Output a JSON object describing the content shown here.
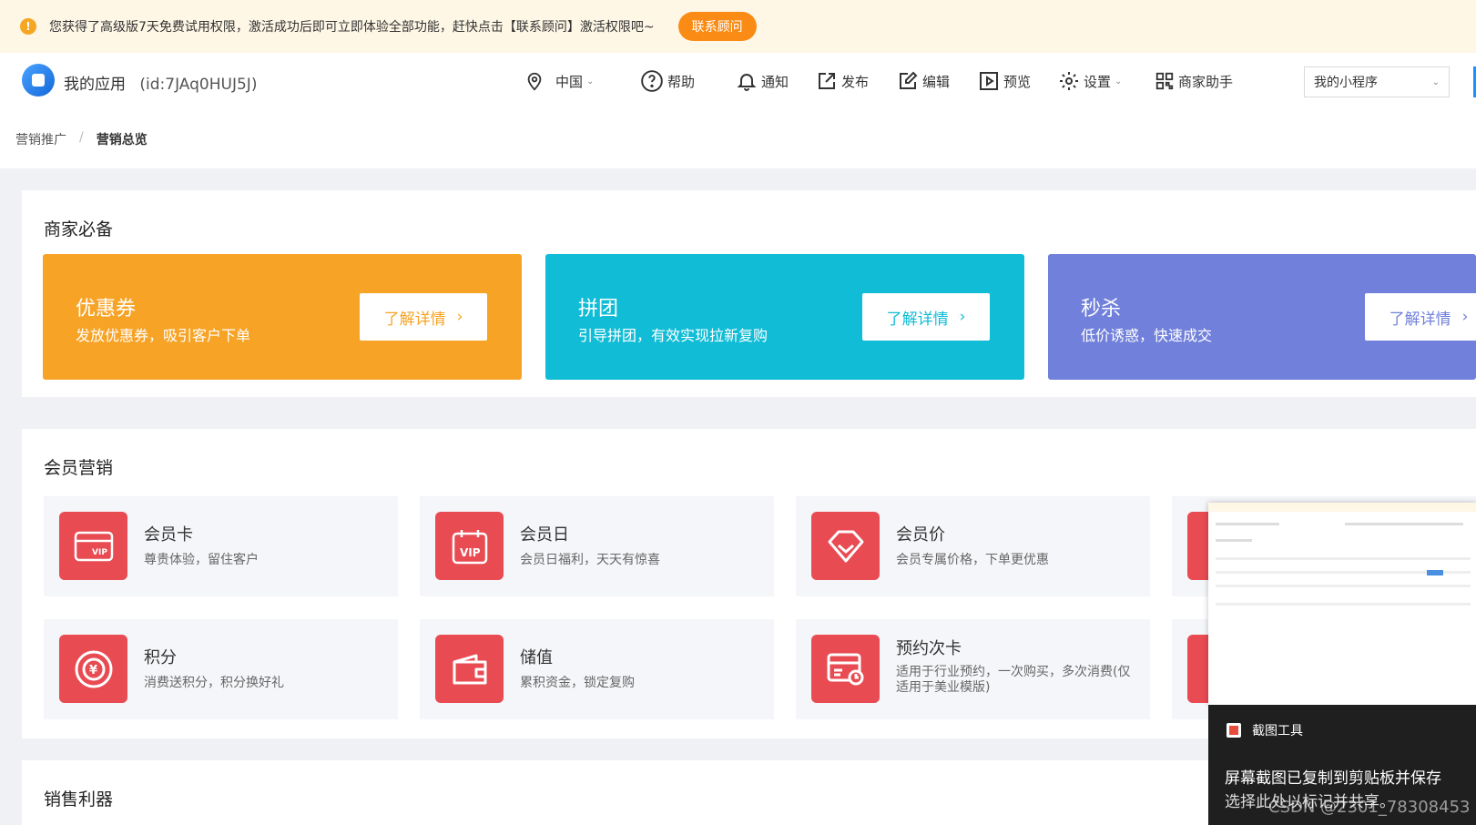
{
  "notice": {
    "icon": "warning-icon",
    "text": "您获得了高级版7天免费试用权限，激活成功后即可立即体验全部功能，赶快点击【联系顾问】激活权限吧~",
    "button": "联系顾问"
  },
  "header": {
    "app_title": "我的应用",
    "app_id": "(id:7JAq0HUJ5J)",
    "region": "中国",
    "help": "帮助",
    "notify": "通知",
    "publish": "发布",
    "edit": "编辑",
    "preview": "预览",
    "settings": "设置",
    "merchant_helper": "商家助手",
    "miniprogram_select": "我的小程序"
  },
  "breadcrumb": {
    "parent": "营销推广",
    "separator": "/",
    "current": "营销总览"
  },
  "essentials": {
    "title": "商家必备",
    "items": [
      {
        "title": "优惠券",
        "subtitle": "发放优惠券，吸引客户下单",
        "button": "了解详情",
        "color": "#f7a326"
      },
      {
        "title": "拼团",
        "subtitle": "引导拼团，有效实现拉新复购",
        "button": "了解详情",
        "color": "#10bcd6"
      },
      {
        "title": "秒杀",
        "subtitle": "低价诱惑，快速成交",
        "button": "了解详情",
        "color": "#7180da"
      }
    ]
  },
  "member": {
    "title": "会员营销",
    "items": [
      {
        "title": "会员卡",
        "desc": "尊贵体验，留住客户",
        "icon": "vip-card-icon"
      },
      {
        "title": "会员日",
        "desc": "会员日福利，天天有惊喜",
        "icon": "vip-calendar-icon"
      },
      {
        "title": "会员价",
        "desc": "会员专属价格，下单更优惠",
        "icon": "diamond-icon"
      },
      {
        "title": "积分",
        "desc": "消费送积分，积分换好礼",
        "icon": "points-icon"
      },
      {
        "title": "储值",
        "desc": "累积资金，锁定复购",
        "icon": "wallet-icon"
      },
      {
        "title": "预约次卡",
        "desc": "适用于行业预约，一次购买，多次消费(仅适用于美业模版)",
        "icon": "booking-card-icon"
      }
    ]
  },
  "sales": {
    "title": "销售利器"
  },
  "snip_tool": {
    "title": "截图工具",
    "message_line1": "屏幕截图已复制到剪贴板并保存",
    "message_line2": "选择此处以标记并共享。"
  },
  "watermark": "CSDN @2301_78308453"
}
